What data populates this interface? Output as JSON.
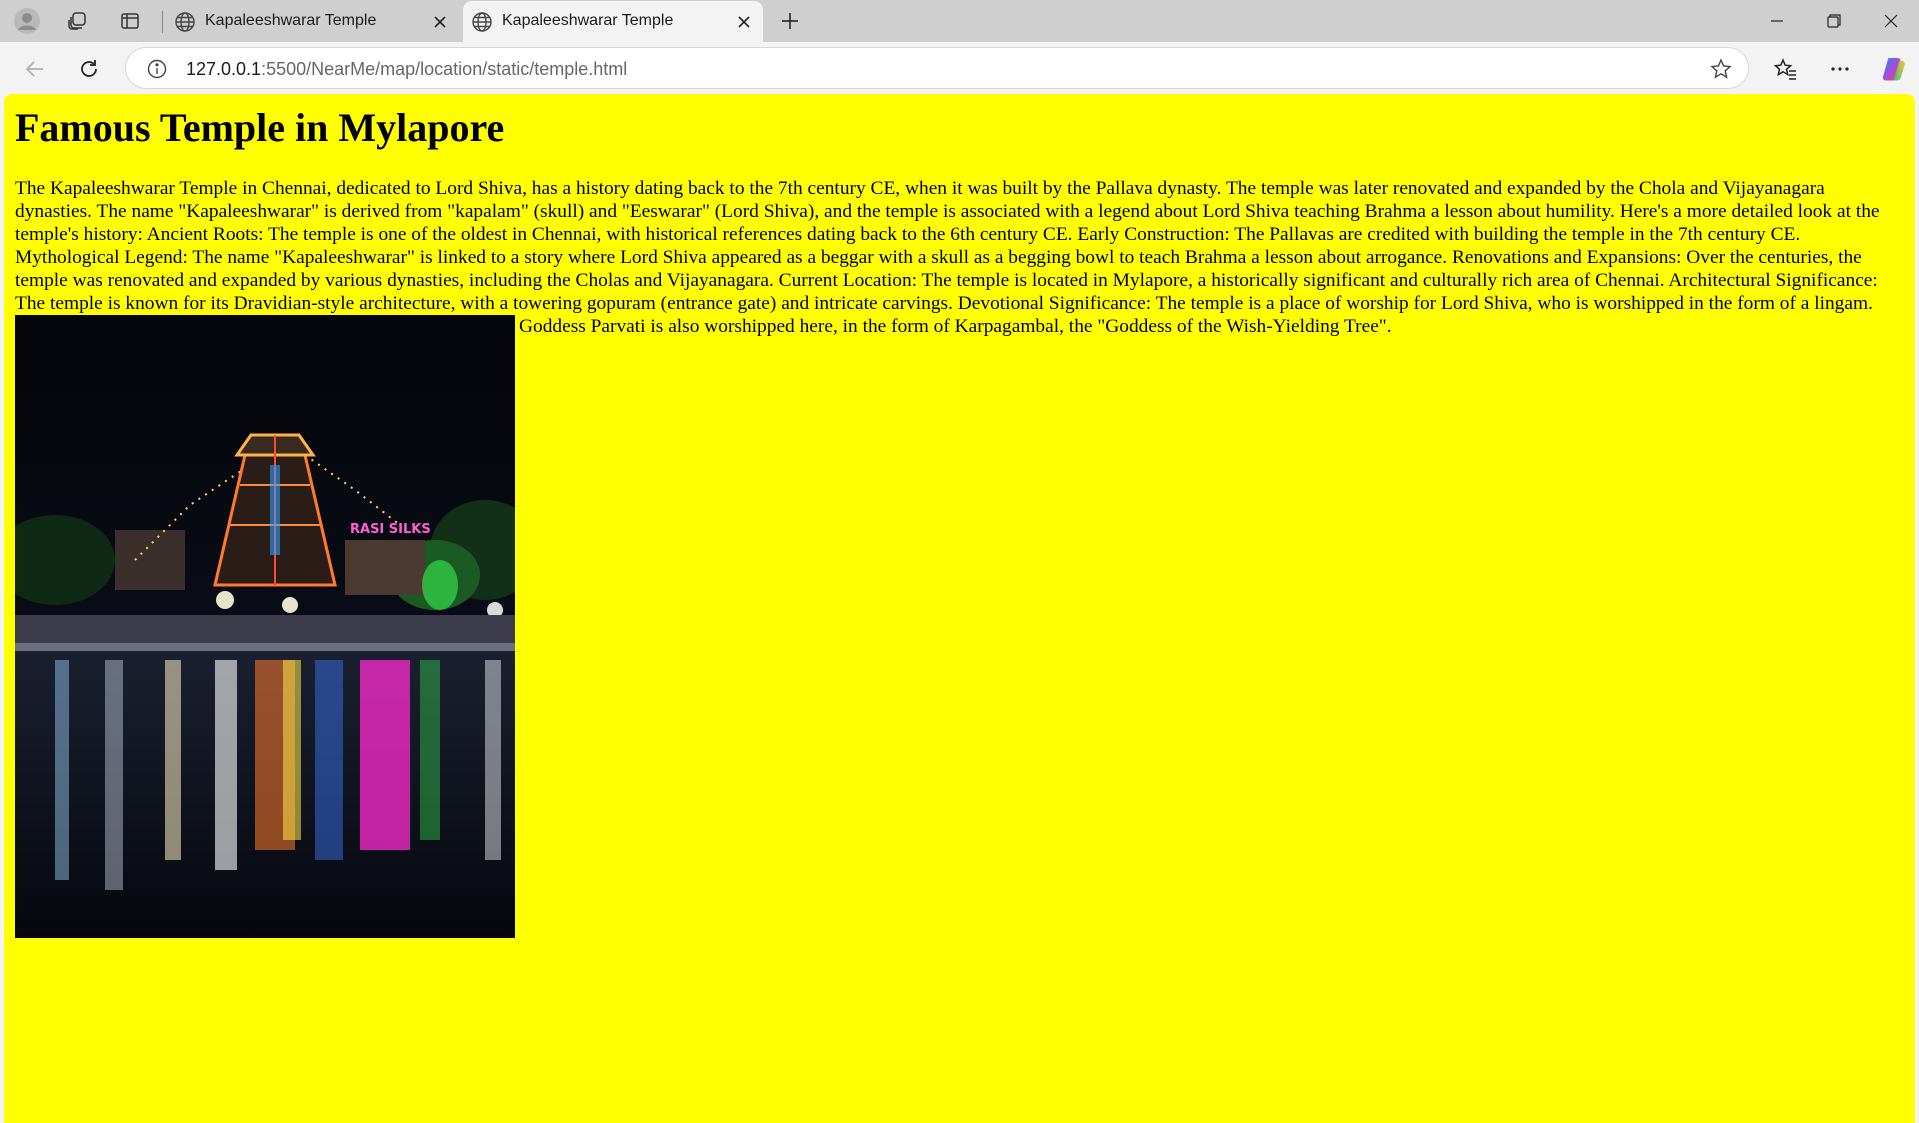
{
  "browser": {
    "tabs": [
      {
        "title": "Kapaleeshwarar Temple",
        "active": false
      },
      {
        "title": "Kapaleeshwarar Temple",
        "active": true
      }
    ],
    "address": {
      "host": "127.0.0.1",
      "path": ":5500/NearMe/map/location/static/temple.html"
    },
    "colors": {
      "tabbar": "#cfcfcf",
      "page_background": "#ffff00"
    }
  },
  "page": {
    "heading": "Famous Temple in Mylapore",
    "body_before_image": "The Kapaleeshwarar Temple in Chennai, dedicated to Lord Shiva, has a history dating back to the 7th century CE, when it was built by the Pallava dynasty. The temple was later renovated and expanded by the Chola and Vijayanagara dynasties. The name \"Kapaleeshwarar\" is derived from \"kapalam\" (skull) and \"Eeswarar\" (Lord Shiva), and the temple is associated with a legend about Lord Shiva teaching Brahma a lesson about humility. Here's a more detailed look at the temple's history: Ancient Roots: The temple is one of the oldest in Chennai, with historical references dating back to the 6th century CE. Early Construction: The Pallavas are credited with building the temple in the 7th century CE. Mythological Legend: The name \"Kapaleeshwarar\" is linked to a story where Lord Shiva appeared as a beggar with a skull as a begging bowl to teach Brahma a lesson about arrogance. Renovations and Expansions: Over the centuries, the temple was renovated and expanded by various dynasties, including the Cholas and Vijayanagara. Current Location: The temple is located in Mylapore, a historically significant and culturally rich area of Chennai. Architectural Significance: The temple is known for its Dravidian-style architecture, with a towering gopuram (entrance gate) and intricate carvings. Devotional Significance: The temple is a place of worship for Lord Shiva, who is",
    "body_after_image": "worshipped in the form of a lingam. Goddess Parvati is also worshipped here, in the form of Karpagambal, the \"Goddess of the Wish-Yielding Tree\".",
    "image": {
      "sign_text": "RASI SILKS"
    }
  }
}
